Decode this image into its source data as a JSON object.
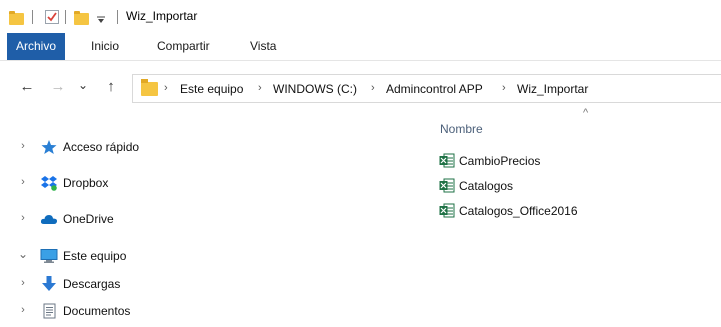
{
  "window": {
    "title": "Wiz_Importar"
  },
  "quick_access": {
    "icons": [
      "folder-icon",
      "properties-check-icon",
      "new-folder-icon",
      "customize-dropdown-icon"
    ]
  },
  "ribbon": {
    "tabs": [
      {
        "label": "Archivo",
        "active": true
      },
      {
        "label": "Inicio",
        "active": false
      },
      {
        "label": "Compartir",
        "active": false
      },
      {
        "label": "Vista",
        "active": false
      }
    ],
    "accent_color": "#1f5ea8"
  },
  "address": {
    "back": "←",
    "forward": "→",
    "recent": "⌄",
    "up": "↑",
    "breadcrumbs": [
      "Este equipo",
      "WINDOWS (C:)",
      "Admincontrol APP",
      "Wiz_Importar"
    ]
  },
  "nav_pane": {
    "items": [
      {
        "label": "Acceso rápido",
        "icon": "star-icon",
        "expander": "›"
      },
      {
        "label": "Dropbox",
        "icon": "dropbox-icon",
        "expander": "›"
      },
      {
        "label": "OneDrive",
        "icon": "cloud-icon",
        "expander": "›"
      },
      {
        "label": "Este equipo",
        "icon": "computer-icon",
        "expander": "⌄"
      },
      {
        "label": "Descargas",
        "icon": "download-arrow-icon",
        "expander": "›"
      },
      {
        "label": "Documentos",
        "icon": "document-icon",
        "expander": "›"
      }
    ]
  },
  "file_list": {
    "sort_indicator": "^",
    "column_header": "Nombre",
    "files": [
      {
        "name": "CambioPrecios",
        "icon": "excel-file-icon"
      },
      {
        "name": "Catalogos",
        "icon": "excel-file-icon"
      },
      {
        "name": "Catalogos_Office2016",
        "icon": "excel-file-icon"
      }
    ]
  }
}
